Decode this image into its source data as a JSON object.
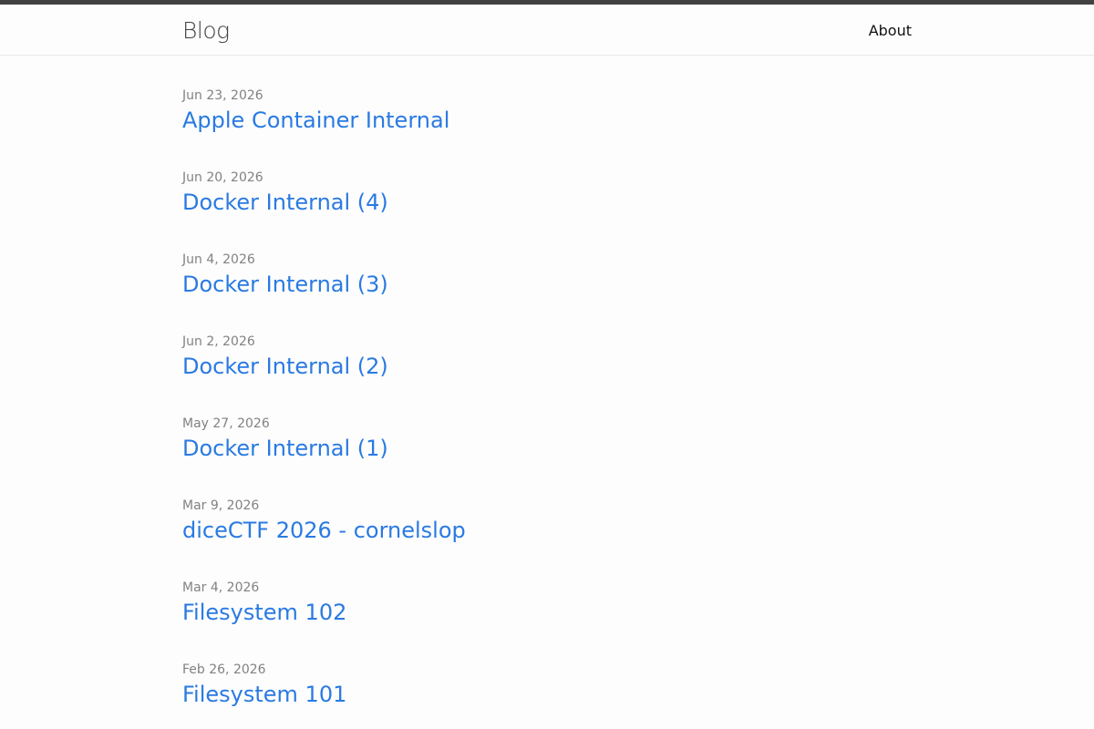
{
  "header": {
    "site_title": "Blog",
    "nav": [
      {
        "label": "About"
      }
    ]
  },
  "posts": [
    {
      "date": "Jun 23, 2026",
      "title": "Apple Container Internal"
    },
    {
      "date": "Jun 20, 2026",
      "title": "Docker Internal (4)"
    },
    {
      "date": "Jun 4, 2026",
      "title": "Docker Internal (3)"
    },
    {
      "date": "Jun 2, 2026",
      "title": "Docker Internal (2)"
    },
    {
      "date": "May 27, 2026",
      "title": "Docker Internal (1)"
    },
    {
      "date": "Mar 9, 2026",
      "title": "diceCTF 2026 - cornelslop"
    },
    {
      "date": "Mar 4, 2026",
      "title": "Filesystem 102"
    },
    {
      "date": "Feb 26, 2026",
      "title": "Filesystem 101"
    }
  ],
  "colors": {
    "accent_bar": "#424242",
    "link": "#2a7ae2",
    "meta": "#828282",
    "background": "#fdfdfd"
  }
}
